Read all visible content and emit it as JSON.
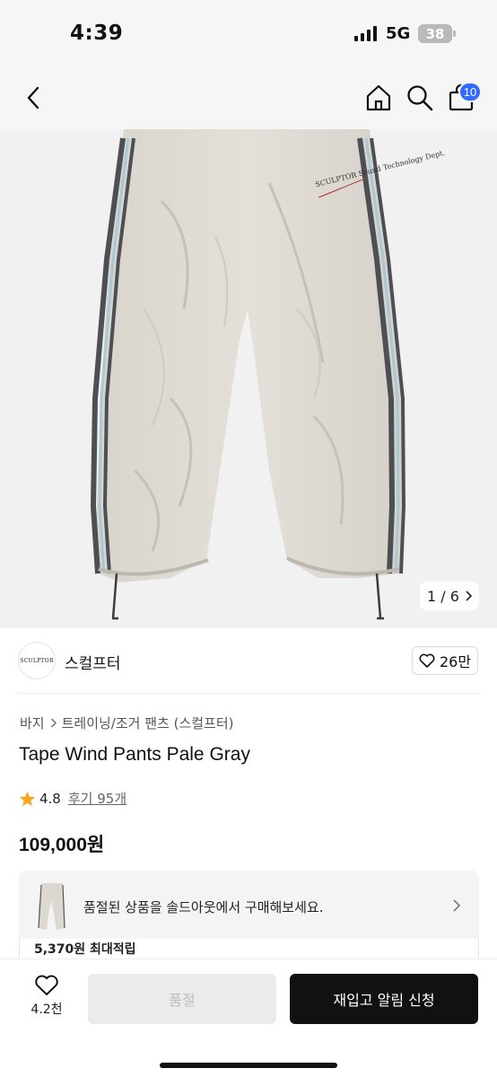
{
  "status": {
    "time": "4:39",
    "network": "5G",
    "battery": "38"
  },
  "nav": {
    "cart_count": "10"
  },
  "image": {
    "counter": "1 / 6",
    "print_text": "SCULPTOR Sound Technology Dept."
  },
  "brand": {
    "logo_text": "SCULPTOR",
    "name": "스컬프터",
    "likes": "26만"
  },
  "breadcrumb": [
    "바지",
    "트레이닝/조거 팬츠 (스컬프터)"
  ],
  "product": {
    "title": "Tape Wind Pants Pale Gray",
    "rating": "4.8",
    "reviews": "후기 95개",
    "price": "109,000원"
  },
  "soldout_notice": "품절된 상품을 솔드아웃에서 구매해보세요.",
  "reward": "5,370원 최대적립",
  "bottom": {
    "wish_count": "4.2천",
    "soldout_label": "품절",
    "restock_label": "재입고 알림 신청"
  },
  "colors": {
    "accent": "#2f6bff",
    "star": "#f5a623",
    "primary_btn": "#111111"
  }
}
